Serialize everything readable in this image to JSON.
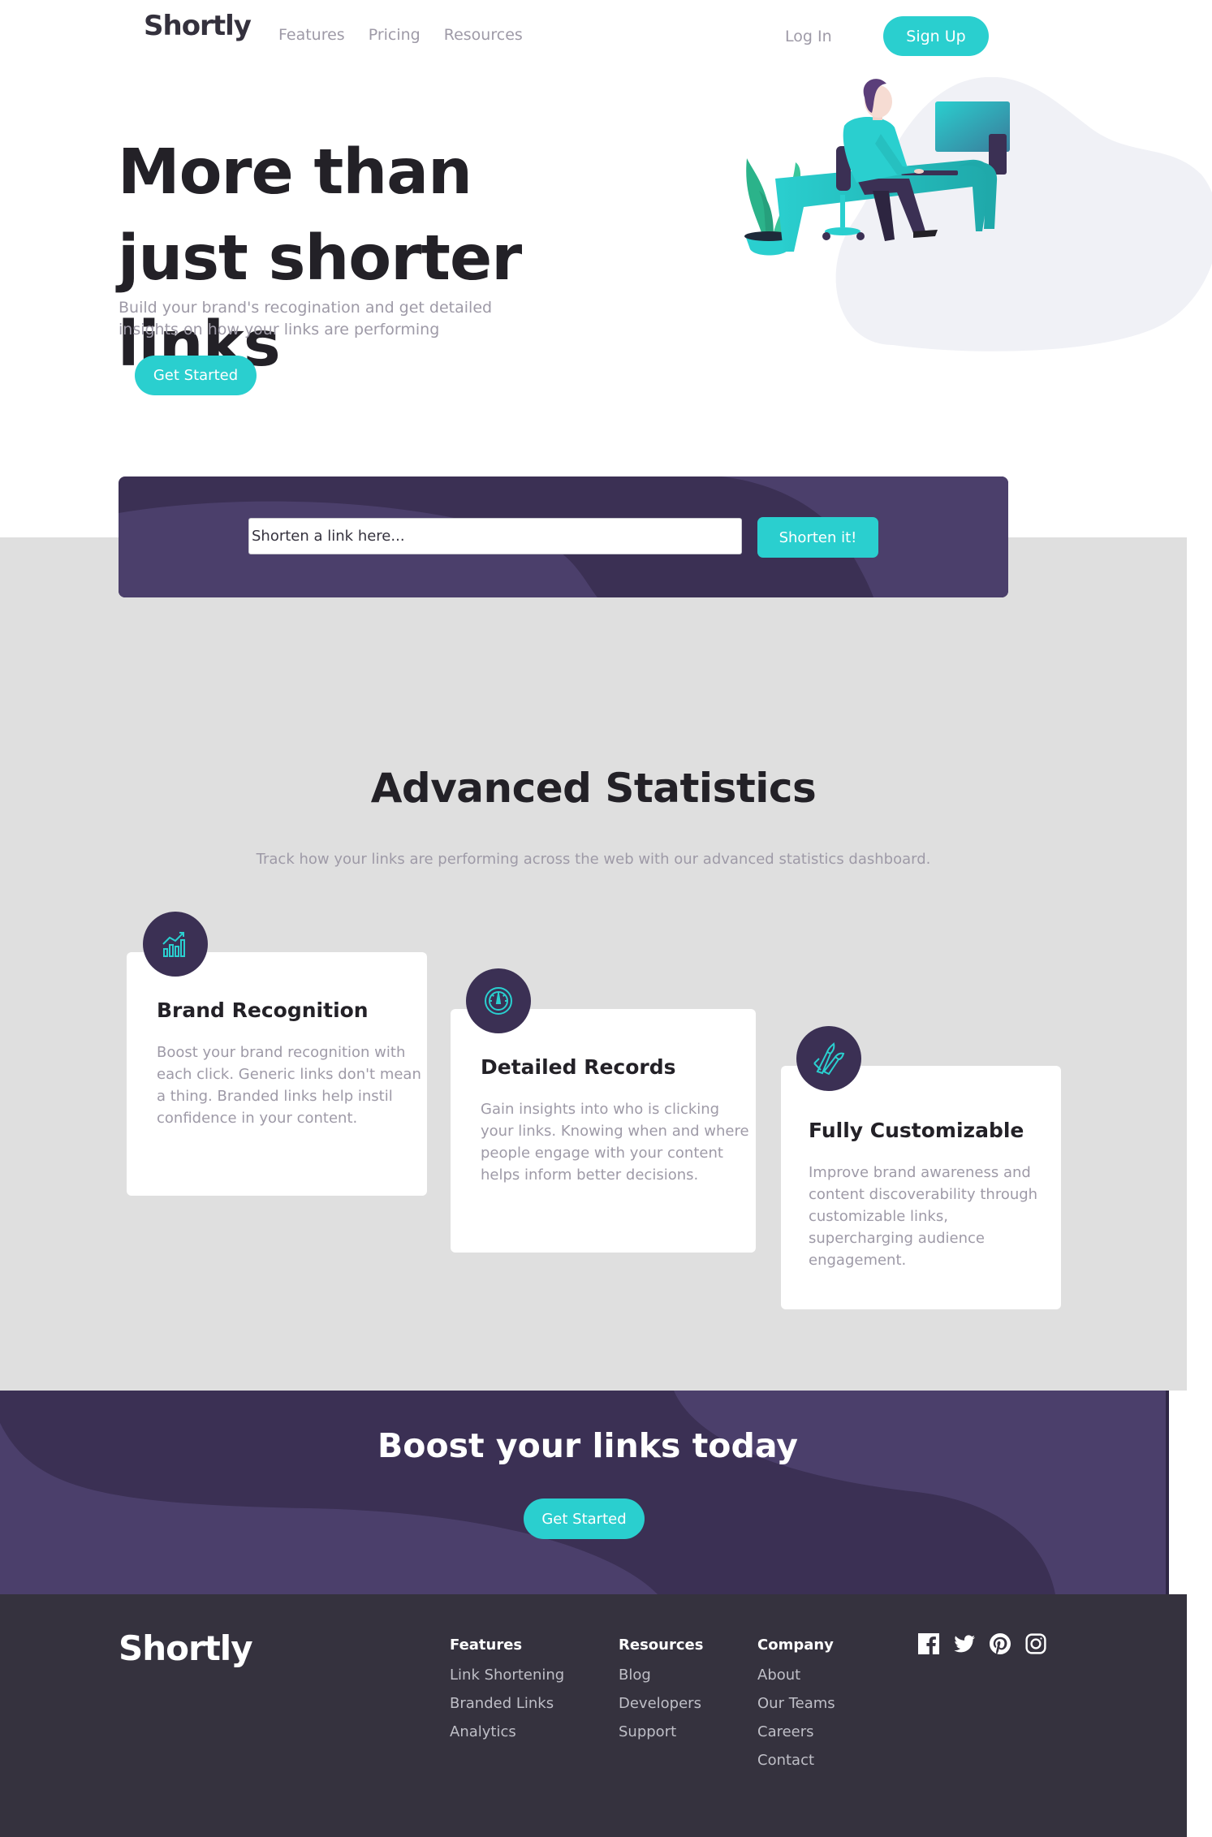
{
  "header": {
    "logo": "Shortly",
    "nav": [
      "Features",
      "Pricing",
      "Resources"
    ],
    "login": "Log In",
    "signup": "Sign Up"
  },
  "hero": {
    "title": "More than just shorter links",
    "subtitle": "Build your brand's recogination and get detailed insights on how your links are performing",
    "cta": "Get Started"
  },
  "shorten": {
    "placeholder": "Shorten a link here...",
    "button": "Shorten it!"
  },
  "stats": {
    "title": "Advanced Statistics",
    "subtitle": "Track how your links are performing across the web with our advanced statistics dashboard.",
    "cards": [
      {
        "title": "Brand Recognition",
        "text": "Boost your brand recognition with each click. Generic links don't mean a thing. Branded links help instil confidence in your content.",
        "icon": "chart-icon"
      },
      {
        "title": "Detailed Records",
        "text": "Gain insights into who is clicking your links. Knowing when and where people engage with your content helps inform better decisions.",
        "icon": "gauge-icon"
      },
      {
        "title": "Fully Customizable",
        "text": "Improve brand awareness and content discoverability through customizable links, supercharging audience engagement.",
        "icon": "brushes-icon"
      }
    ]
  },
  "boost": {
    "title": "Boost your links today",
    "cta": "Get Started"
  },
  "footer": {
    "logo": "Shortly",
    "columns": [
      {
        "title": "Features",
        "links": [
          "Link Shortening",
          "Branded Links",
          "Analytics"
        ]
      },
      {
        "title": "Resources",
        "links": [
          "Blog",
          "Developers",
          "Support"
        ]
      },
      {
        "title": "Company",
        "links": [
          "About",
          "Our Teams",
          "Careers",
          "Contact"
        ]
      }
    ],
    "socials": [
      "facebook-icon",
      "twitter-icon",
      "pinterest-icon",
      "instagram-icon"
    ]
  },
  "colors": {
    "cyan": "#2acfcf",
    "dark_violet": "#3b3054",
    "grey_violet": "#9e9aa7",
    "very_dark_blue": "#35323e",
    "very_dark_violet": "#232127",
    "grey_bg": "#dfdfdf"
  }
}
